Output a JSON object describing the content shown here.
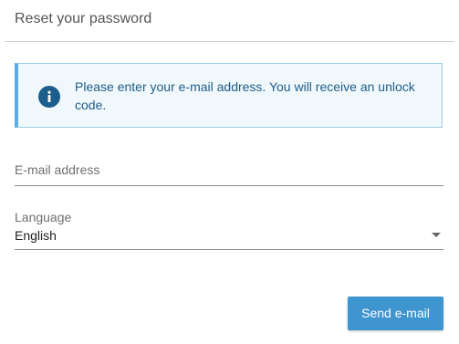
{
  "dialog": {
    "title": "Reset your password"
  },
  "info": {
    "icon": "info-icon",
    "message": "Please enter your e-mail address. You will receive an unlock code.",
    "colors": {
      "background": "#f1f8fc",
      "border": "#5dade2",
      "text": "#1d5d88"
    }
  },
  "form": {
    "email": {
      "placeholder": "E-mail address",
      "value": ""
    },
    "language": {
      "label": "Language",
      "selected": "English"
    }
  },
  "actions": {
    "send_label": "Send e-mail",
    "send_color": "#3f95cf"
  }
}
